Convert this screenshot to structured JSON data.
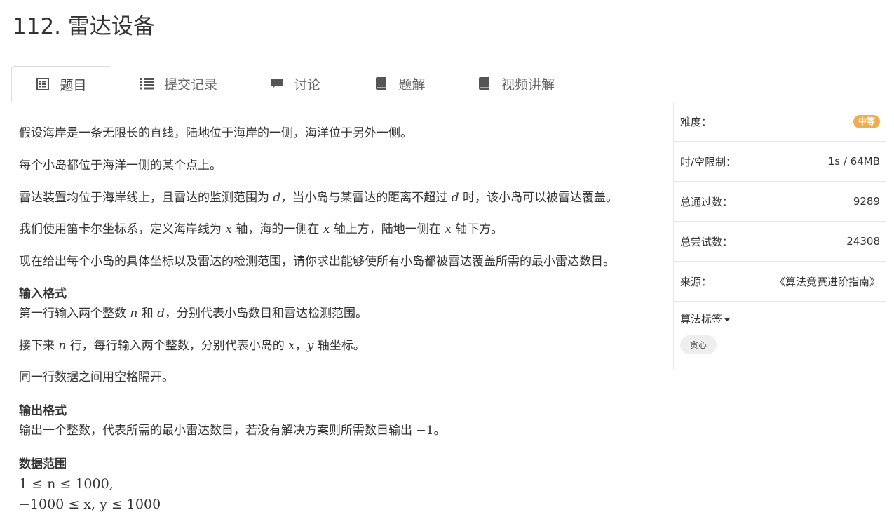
{
  "problem": {
    "title": "112. 雷达设备"
  },
  "tabs": [
    {
      "label": "题目",
      "icon": "list-alt-icon",
      "active": true
    },
    {
      "label": "提交记录",
      "icon": "list-icon",
      "active": false
    },
    {
      "label": "讨论",
      "icon": "comment-icon",
      "active": false
    },
    {
      "label": "题解",
      "icon": "book-icon",
      "active": false
    },
    {
      "label": "视频讲解",
      "icon": "book-icon",
      "active": false
    }
  ],
  "description": {
    "p1": "假设海岸是一条无限长的直线，陆地位于海岸的一侧，海洋位于另外一侧。",
    "p2": "每个小岛都位于海洋一侧的某个点上。",
    "p3_a": "雷达装置均位于海岸线上，且雷达的监测范围为 ",
    "p3_v1": "d",
    "p3_b": "，当小岛与某雷达的距离不超过 ",
    "p3_v2": "d",
    "p3_c": " 时，该小岛可以被雷达覆盖。",
    "p4_a": "我们使用笛卡尔坐标系，定义海岸线为 ",
    "p4_v1": "x",
    "p4_b": " 轴，海的一侧在 ",
    "p4_v2": "x",
    "p4_c": " 轴上方，陆地一侧在 ",
    "p4_v3": "x",
    "p4_d": " 轴下方。",
    "p5": "现在给出每个小岛的具体坐标以及雷达的检测范围，请你求出能够使所有小岛都被雷达覆盖所需的最小雷达数目。"
  },
  "input_format": {
    "heading": "输入格式",
    "l1_a": "第一行输入两个整数 ",
    "l1_v1": "n",
    "l1_b": " 和 ",
    "l1_v2": "d",
    "l1_c": "，分别代表小岛数目和雷达检测范围。",
    "l2_a": "接下来 ",
    "l2_v1": "n",
    "l2_b": " 行，每行输入两个整数，分别代表小岛的 ",
    "l2_v2": "x",
    "l2_c": "，",
    "l2_v3": "y",
    "l2_d": " 轴坐标。",
    "l3": "同一行数据之间用空格隔开。"
  },
  "output_format": {
    "heading": "输出格式",
    "text_a": "输出一个整数，代表所需的最小雷达数目，若没有解决方案则所需数目输出 ",
    "text_v": "−1",
    "text_b": "。"
  },
  "data_range": {
    "heading": "数据范围",
    "f1": "1 ≤ n ≤ 1000,",
    "f2": "−1000 ≤ x, y ≤ 1000"
  },
  "sidebar": {
    "difficulty_label": "难度：",
    "difficulty_value": "中等",
    "limit_label": "时/空限制：",
    "limit_value": "1s / 64MB",
    "passed_label": "总通过数：",
    "passed_value": "9289",
    "attempts_label": "总尝试数：",
    "attempts_value": "24308",
    "source_label": "来源：",
    "source_value": "《算法竞赛进阶指南》",
    "tags_label": "算法标签",
    "tags": [
      "贪心"
    ]
  },
  "colors": {
    "difficulty_badge": "#f0ad4e",
    "tab_border": "#dddddd",
    "text": "#333333"
  }
}
